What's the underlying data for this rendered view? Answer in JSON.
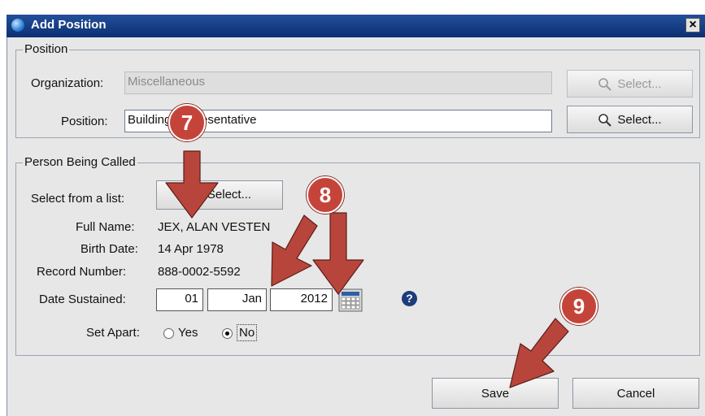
{
  "window": {
    "title": "Add Position",
    "close_glyph": "×"
  },
  "position_group": {
    "legend": "Position",
    "organization_label": "Organization:",
    "organization_value": "Miscellaneous",
    "position_label": "Position:",
    "position_value": "Building Representative",
    "select_label": "Select..."
  },
  "person_group": {
    "legend": "Person Being Called",
    "select_list_label": "Select from a list:",
    "select_label": "Select...",
    "full_name_label": "Full Name:",
    "full_name_value": "JEX, ALAN VESTEN",
    "birth_date_label": "Birth Date:",
    "birth_date_value": "14 Apr 1978",
    "record_number_label": "Record Number:",
    "record_number_value": "888-0002-5592",
    "date_sustained_label": "Date Sustained:",
    "date_day": "01",
    "date_month": "Jan",
    "date_year": "2012",
    "set_apart_label": "Set Apart:",
    "set_apart_options": [
      "Yes",
      "No"
    ],
    "set_apart_selected": "No",
    "help_glyph": "?"
  },
  "footer": {
    "save_label": "Save",
    "cancel_label": "Cancel"
  },
  "annotations": {
    "step_a": "7",
    "step_b": "8",
    "step_c": "9",
    "color": "#c5443a"
  },
  "icons": [
    "globe-icon",
    "close-icon",
    "magnifier-icon",
    "calendar-icon",
    "help-icon",
    "radio-icon",
    "arrow-icon"
  ]
}
